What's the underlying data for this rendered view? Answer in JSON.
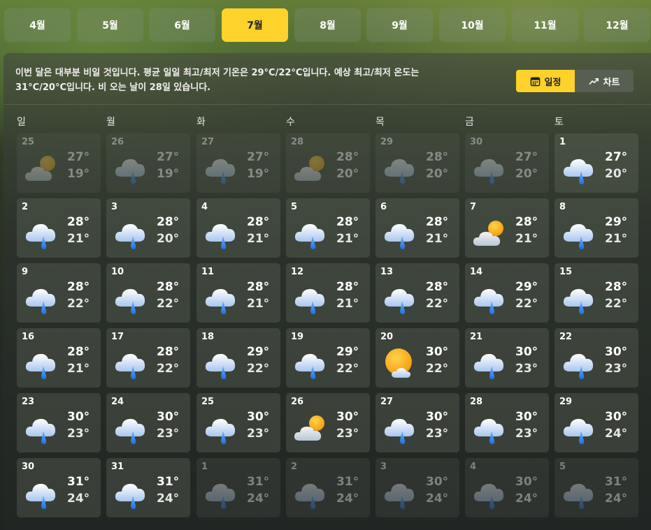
{
  "months": [
    "4월",
    "5월",
    "6월",
    "7월",
    "8월",
    "9월",
    "10월",
    "11월",
    "12월"
  ],
  "active_month": "7월",
  "summary": "이번 달은 대부분 비일 것입니다. 평균 일일 최고/최저 기온은 29°C/22°C입니다. 예상 최고/최저 온도는 31°C/20°C입니다. 비 오는 날이 28일 있습니다.",
  "view_toggle": {
    "calendar_label": "일정",
    "chart_label": "차트",
    "active": "calendar"
  },
  "weekdays": [
    "일",
    "월",
    "화",
    "수",
    "목",
    "금",
    "토"
  ],
  "colors": {
    "accent": "#fcd22b"
  },
  "days": [
    {
      "date": "25",
      "hi": "27°",
      "lo": "19°",
      "icon": "partly-cloudy-icon",
      "dim": true
    },
    {
      "date": "26",
      "hi": "27°",
      "lo": "19°",
      "icon": "rain-icon",
      "dim": true
    },
    {
      "date": "27",
      "hi": "27°",
      "lo": "19°",
      "icon": "rain-icon",
      "dim": true
    },
    {
      "date": "28",
      "hi": "28°",
      "lo": "20°",
      "icon": "partly-cloudy-icon",
      "dim": true
    },
    {
      "date": "29",
      "hi": "28°",
      "lo": "20°",
      "icon": "rain-icon",
      "dim": true
    },
    {
      "date": "30",
      "hi": "27°",
      "lo": "20°",
      "icon": "rain-icon",
      "dim": true
    },
    {
      "date": "1",
      "hi": "27°",
      "lo": "20°",
      "icon": "rain-icon",
      "dim": false
    },
    {
      "date": "2",
      "hi": "28°",
      "lo": "21°",
      "icon": "rain-icon",
      "dim": false
    },
    {
      "date": "3",
      "hi": "28°",
      "lo": "20°",
      "icon": "rain-icon",
      "dim": false
    },
    {
      "date": "4",
      "hi": "28°",
      "lo": "21°",
      "icon": "rain-icon",
      "dim": false
    },
    {
      "date": "5",
      "hi": "28°",
      "lo": "21°",
      "icon": "rain-icon",
      "dim": false
    },
    {
      "date": "6",
      "hi": "28°",
      "lo": "21°",
      "icon": "rain-icon",
      "dim": false
    },
    {
      "date": "7",
      "hi": "28°",
      "lo": "21°",
      "icon": "partly-cloudy-icon",
      "dim": false
    },
    {
      "date": "8",
      "hi": "29°",
      "lo": "21°",
      "icon": "rain-icon",
      "dim": false
    },
    {
      "date": "9",
      "hi": "28°",
      "lo": "22°",
      "icon": "rain-icon",
      "dim": false
    },
    {
      "date": "10",
      "hi": "28°",
      "lo": "22°",
      "icon": "rain-icon",
      "dim": false
    },
    {
      "date": "11",
      "hi": "28°",
      "lo": "21°",
      "icon": "rain-icon",
      "dim": false
    },
    {
      "date": "12",
      "hi": "28°",
      "lo": "21°",
      "icon": "rain-icon",
      "dim": false
    },
    {
      "date": "13",
      "hi": "28°",
      "lo": "22°",
      "icon": "rain-icon",
      "dim": false
    },
    {
      "date": "14",
      "hi": "29°",
      "lo": "22°",
      "icon": "rain-icon",
      "dim": false
    },
    {
      "date": "15",
      "hi": "28°",
      "lo": "22°",
      "icon": "rain-icon",
      "dim": false
    },
    {
      "date": "16",
      "hi": "28°",
      "lo": "21°",
      "icon": "rain-icon",
      "dim": false
    },
    {
      "date": "17",
      "hi": "28°",
      "lo": "22°",
      "icon": "rain-icon",
      "dim": false
    },
    {
      "date": "18",
      "hi": "29°",
      "lo": "22°",
      "icon": "rain-icon",
      "dim": false
    },
    {
      "date": "19",
      "hi": "29°",
      "lo": "22°",
      "icon": "rain-icon",
      "dim": false
    },
    {
      "date": "20",
      "hi": "30°",
      "lo": "22°",
      "icon": "mostly-sunny-icon",
      "dim": false
    },
    {
      "date": "21",
      "hi": "30°",
      "lo": "23°",
      "icon": "rain-icon",
      "dim": false
    },
    {
      "date": "22",
      "hi": "30°",
      "lo": "23°",
      "icon": "rain-icon",
      "dim": false
    },
    {
      "date": "23",
      "hi": "30°",
      "lo": "23°",
      "icon": "rain-icon",
      "dim": false
    },
    {
      "date": "24",
      "hi": "30°",
      "lo": "23°",
      "icon": "rain-icon",
      "dim": false
    },
    {
      "date": "25",
      "hi": "30°",
      "lo": "23°",
      "icon": "rain-icon",
      "dim": false
    },
    {
      "date": "26",
      "hi": "30°",
      "lo": "23°",
      "icon": "partly-cloudy-icon",
      "dim": false
    },
    {
      "date": "27",
      "hi": "30°",
      "lo": "23°",
      "icon": "rain-icon",
      "dim": false
    },
    {
      "date": "28",
      "hi": "30°",
      "lo": "23°",
      "icon": "rain-icon",
      "dim": false
    },
    {
      "date": "29",
      "hi": "30°",
      "lo": "24°",
      "icon": "rain-icon",
      "dim": false
    },
    {
      "date": "30",
      "hi": "31°",
      "lo": "24°",
      "icon": "rain-icon",
      "dim": false
    },
    {
      "date": "31",
      "hi": "31°",
      "lo": "24°",
      "icon": "rain-icon",
      "dim": false
    },
    {
      "date": "1",
      "hi": "31°",
      "lo": "24°",
      "icon": "rain-icon",
      "dim": true
    },
    {
      "date": "2",
      "hi": "31°",
      "lo": "24°",
      "icon": "rain-icon",
      "dim": true
    },
    {
      "date": "3",
      "hi": "30°",
      "lo": "24°",
      "icon": "rain-icon",
      "dim": true
    },
    {
      "date": "4",
      "hi": "30°",
      "lo": "24°",
      "icon": "rain-icon",
      "dim": true
    },
    {
      "date": "5",
      "hi": "31°",
      "lo": "24°",
      "icon": "rain-icon",
      "dim": true
    }
  ]
}
